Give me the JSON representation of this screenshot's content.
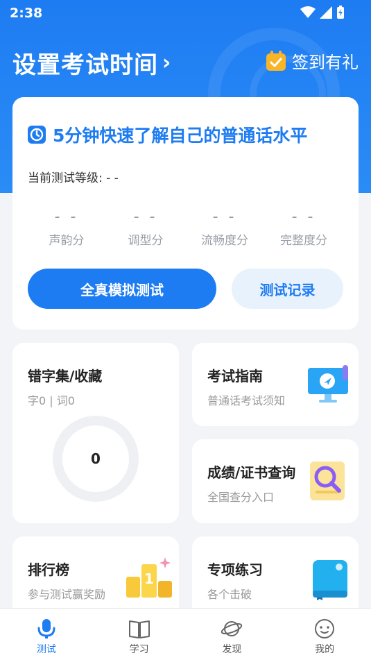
{
  "status": {
    "time": "2:38"
  },
  "header": {
    "title": "设置考试时间",
    "checkin_label": "签到有礼"
  },
  "main_card": {
    "heading": "5分钟快速了解自己的普通话水平",
    "level_label": "当前测试等级:",
    "level_value": "- -",
    "scores": [
      {
        "value": "- -",
        "label": "声韵分"
      },
      {
        "value": "- -",
        "label": "调型分"
      },
      {
        "value": "- -",
        "label": "流畅度分"
      },
      {
        "value": "- -",
        "label": "完整度分"
      }
    ],
    "primary_button": "全真模拟测试",
    "secondary_button": "测试记录"
  },
  "tiles": {
    "wrong_words": {
      "title": "错字集/收藏",
      "subtitle": "字0 | 词0",
      "count": "0"
    },
    "guide": {
      "title": "考试指南",
      "subtitle": "普通话考试须知"
    },
    "score_query": {
      "title": "成绩/证书查询",
      "subtitle": "全国查分入口"
    },
    "ranking": {
      "title": "排行榜",
      "subtitle": "参与测试赢奖励"
    },
    "practice": {
      "title": "专项练习",
      "subtitle": "各个击破"
    }
  },
  "nav": [
    {
      "label": "测试",
      "icon": "microphone-icon",
      "active": true
    },
    {
      "label": "学习",
      "icon": "book-icon",
      "active": false
    },
    {
      "label": "发现",
      "icon": "planet-icon",
      "active": false
    },
    {
      "label": "我的",
      "icon": "face-icon",
      "active": false
    }
  ],
  "colors": {
    "primary": "#1e7cf2",
    "background": "#f2f4f7",
    "muted": "#999999"
  }
}
